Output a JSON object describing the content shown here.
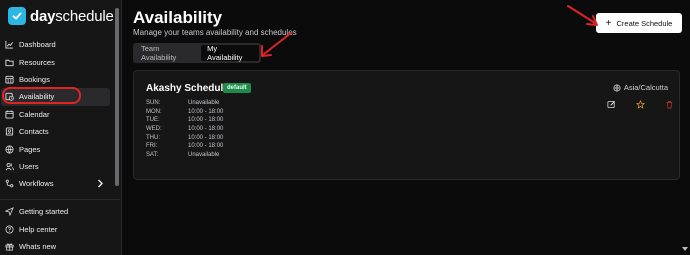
{
  "app": {
    "logo_part1": "day",
    "logo_part2": "schedule"
  },
  "sidebar": {
    "items": [
      {
        "label": "Dashboard",
        "icon": "chart-icon"
      },
      {
        "label": "Resources",
        "icon": "folder-icon"
      },
      {
        "label": "Bookings",
        "icon": "calendar-grid-icon"
      },
      {
        "label": "Availability",
        "icon": "calendar-clock-icon",
        "active": true
      },
      {
        "label": "Calendar",
        "icon": "calendar-icon"
      },
      {
        "label": "Contacts",
        "icon": "contacts-icon"
      },
      {
        "label": "Pages",
        "icon": "globe-icon"
      },
      {
        "label": "Users",
        "icon": "users-icon"
      },
      {
        "label": "Workflows",
        "icon": "workflow-icon"
      }
    ],
    "bottom": [
      {
        "label": "Getting started",
        "icon": "send-icon"
      },
      {
        "label": "Help center",
        "icon": "help-icon"
      },
      {
        "label": "Whats new",
        "icon": "gift-icon"
      }
    ]
  },
  "header": {
    "title": "Availability",
    "subtitle": "Manage your teams availability and schedules",
    "create_label": "Create Schedule"
  },
  "tabs": [
    {
      "label": "Team Availability",
      "active": false
    },
    {
      "label": "My Availability",
      "active": true
    }
  ],
  "schedule": {
    "name": "Akashy Schedule",
    "badge": "default",
    "timezone": "Asia/Calcutta",
    "days": [
      {
        "day": "SUN:",
        "hours": "Unavailable"
      },
      {
        "day": "MON:",
        "hours": "10:00 - 18:00"
      },
      {
        "day": "TUE:",
        "hours": "10:00 - 18:00"
      },
      {
        "day": "WED:",
        "hours": "10:00 - 18:00"
      },
      {
        "day": "THU:",
        "hours": "10:00 - 18:00"
      },
      {
        "day": "FRI:",
        "hours": "10:00 - 18:00"
      },
      {
        "day": "SAT:",
        "hours": "Unavailable"
      }
    ]
  },
  "colors": {
    "accent": "#2bb6e4",
    "badge": "#1e8a4c",
    "annotation": "#e02424",
    "star": "#e0a030",
    "delete": "#c0392b"
  }
}
